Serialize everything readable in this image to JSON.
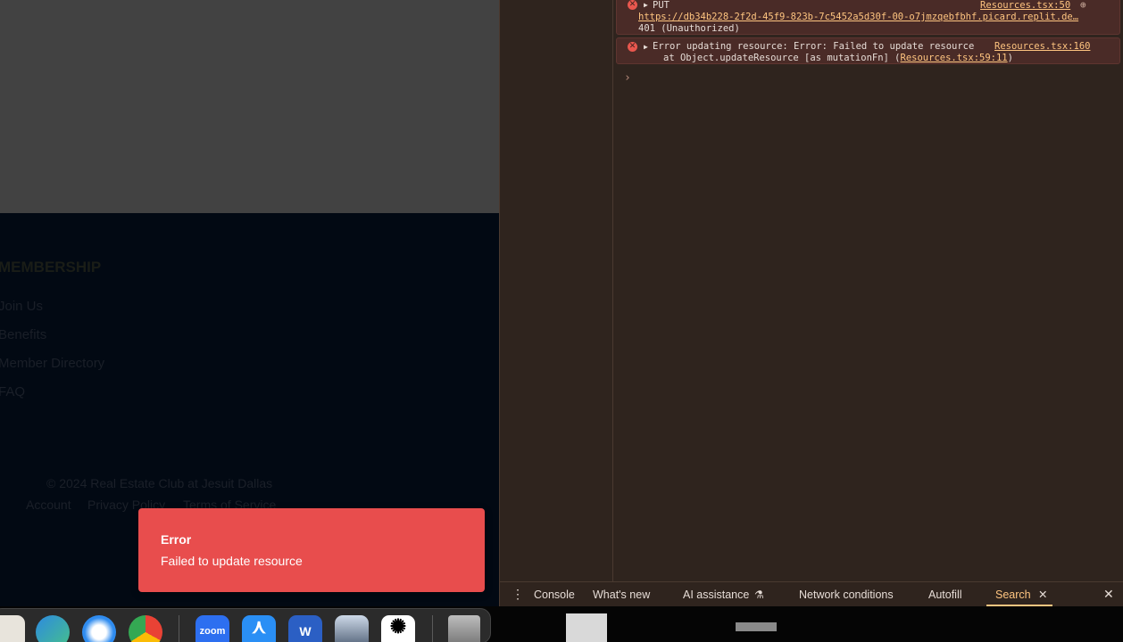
{
  "footer": {
    "heading": "MEMBERSHIP",
    "links": [
      "Join Us",
      "Benefits",
      "Member Directory",
      "FAQ"
    ],
    "copyright": "© 2024 Real Estate Club at Jesuit Dallas",
    "bottom_links": [
      "Account",
      "Privacy Policy",
      "Terms of Service"
    ]
  },
  "toast": {
    "title": "Error",
    "message": "Failed to update resource"
  },
  "console": {
    "entry1": {
      "method": "PUT",
      "source": "Resources.tsx:50",
      "url": "https://db34b228-2f2d-45f9-823b-7c5452a5d30f-00-o7jmzqebfbhf.picard.replit.de…",
      "status": "401 (Unauthorized)"
    },
    "entry2": {
      "message": "Error updating resource: Error: Failed to update resource",
      "source": "Resources.tsx:160",
      "stack_prefix": "at Object.updateResource [as mutationFn] (",
      "stack_link": "Resources.tsx:59:11",
      "stack_suffix": ")"
    },
    "prompt": "›"
  },
  "drawer": {
    "tabs": [
      "Console",
      "What's new",
      "AI assistance",
      "Network conditions",
      "Autofill",
      "Search"
    ],
    "active_tab": "Search"
  },
  "dock": {
    "apps": [
      "Preview",
      "Edge",
      "Safari",
      "Chrome",
      "Zoom",
      "App Store",
      "Word",
      "Preview 2",
      "ChatGPT",
      "Trash"
    ],
    "zoom_label": "zoom",
    "word_label": "W"
  },
  "colors": {
    "toast_bg": "#e84d4d",
    "devtools_bg": "#2f241e",
    "error_row_bg": "#4a2b27",
    "link": "#ffc580",
    "footer_bg": "#020913"
  }
}
